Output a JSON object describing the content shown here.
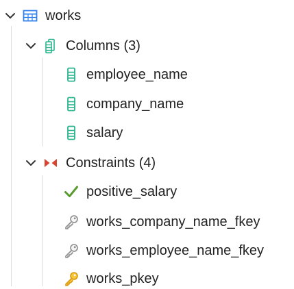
{
  "tree": {
    "table": {
      "label": "works",
      "icon": "table-icon",
      "expanded": true
    },
    "columns": {
      "label": "Columns (3)",
      "icon": "columns-icon",
      "expanded": true,
      "items": [
        {
          "label": "employee_name",
          "icon": "column-icon"
        },
        {
          "label": "company_name",
          "icon": "column-icon"
        },
        {
          "label": "salary",
          "icon": "column-icon"
        }
      ]
    },
    "constraints": {
      "label": "Constraints (4)",
      "icon": "constraints-icon",
      "expanded": true,
      "items": [
        {
          "label": "positive_salary",
          "icon": "check-icon"
        },
        {
          "label": "works_company_name_fkey",
          "icon": "foreign-key-icon"
        },
        {
          "label": "works_employee_name_fkey",
          "icon": "foreign-key-icon"
        },
        {
          "label": "works_pkey",
          "icon": "primary-key-icon"
        }
      ]
    }
  },
  "colors": {
    "table_icon": "#2f80ed",
    "column_icon": "#2bb58f",
    "constraint_icon": "#d6452f",
    "check_icon": "#5a9b2f",
    "fkey_icon": "#9a9a9a",
    "pkey_icon": "#f2b51a",
    "text": "#222222",
    "guide": "#dcdcdc"
  }
}
